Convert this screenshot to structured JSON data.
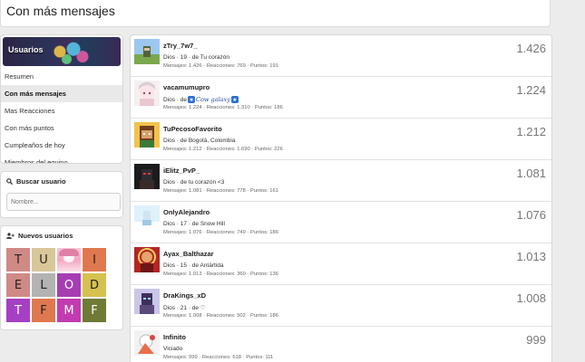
{
  "page": {
    "title": "Con más mensajes"
  },
  "sidebar": {
    "banner_label": "Usuarios",
    "items": [
      {
        "label": "Resumen",
        "active": false
      },
      {
        "label": "Con más mensajes",
        "active": true
      },
      {
        "label": "Mas Reacciones",
        "active": false
      },
      {
        "label": "Con más puntos",
        "active": false
      },
      {
        "label": "Cumpleaños de hoy",
        "active": false
      },
      {
        "label": "Miembros del equipo",
        "active": false
      }
    ],
    "search": {
      "title": "Buscar usuario",
      "placeholder": "Nombre..."
    },
    "new_users": {
      "title": "Nuevos usuarios",
      "tiles": [
        {
          "letter": "T",
          "color": "#cf8a86"
        },
        {
          "letter": "U",
          "color": "#d9c79a"
        },
        {
          "letter": "",
          "color": "#f3a6c1",
          "image": true
        },
        {
          "letter": "I",
          "color": "#e0784f"
        },
        {
          "letter": "E",
          "color": "#cf8a86"
        },
        {
          "letter": "L",
          "color": "#b3b3b3"
        },
        {
          "letter": "O",
          "color": "#a63db3",
          "light": true
        },
        {
          "letter": "D",
          "color": "#d6c14f"
        },
        {
          "letter": "T",
          "color": "#a53fc4",
          "light": true
        },
        {
          "letter": "F",
          "color": "#e0784f"
        },
        {
          "letter": "M",
          "color": "#c23bb0",
          "light": true
        },
        {
          "letter": "F",
          "color": "#6f7a37",
          "light": true
        }
      ]
    }
  },
  "members": [
    {
      "name": "zTry_7w7_",
      "title": "Dios · 19 · de Tu corazón",
      "stats": "Mensajes: 1.426 · Reacciones: 769 · Puntos: 191",
      "count": "1.426",
      "avatar": "grass"
    },
    {
      "name": "vacamumupro",
      "title_prefix": "Dios · de ",
      "title_fancy": "Cow galaxy",
      "title": "",
      "stats": "Mensajes: 1.224 · Reacciones: 1.310 · Puntos: 186",
      "count": "1.224",
      "avatar": "anime"
    },
    {
      "name": "TuPecosoFavorito",
      "title": "Dios · de Bogotá, Colombia",
      "stats": "Mensajes: 1.212 · Reacciones: 1.690 · Puntos: 226",
      "count": "1.212",
      "avatar": "skin"
    },
    {
      "name": "iElitz_PvP_",
      "title": "Dios · de tu corazón <3",
      "stats": "Mensajes: 1.081 · Reacciones: 778 · Puntos: 161",
      "count": "1.081",
      "avatar": "dark"
    },
    {
      "name": "OnlyAlejandro",
      "title": "Dios · 17 · de Snow Hill",
      "stats": "Mensajes: 1.076 · Reacciones: 749 · Puntos: 186",
      "count": "1.076",
      "avatar": "snow"
    },
    {
      "name": "Ayax_Balthazar",
      "title": "Dios · 15 · de Antártida",
      "stats": "Mensajes: 1.013 · Reacciones: 360 · Puntos: 136",
      "count": "1.013",
      "avatar": "red"
    },
    {
      "name": "DraKings_xD",
      "title": "Dios · 21 · de ♡",
      "stats": "Mensajes: 1.008 · Reacciones: 502 · Puntos: 186",
      "count": "1.008",
      "avatar": "purple"
    },
    {
      "name": "Infinito",
      "title": "Viciado",
      "stats": "Mensajes: 999 · Reacciones: 618 · Puntos: 111",
      "count": "999",
      "avatar": "white"
    }
  ]
}
